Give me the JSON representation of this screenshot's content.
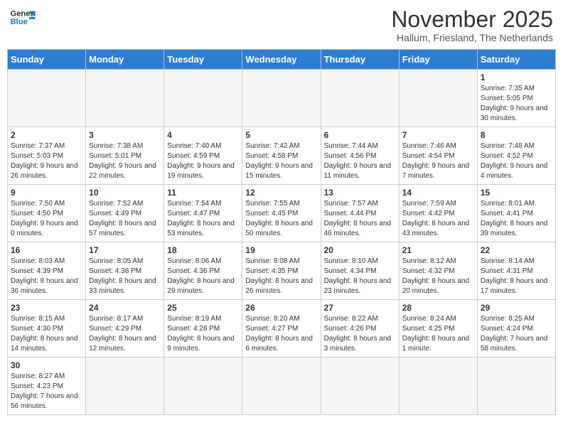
{
  "logo": {
    "text_general": "General",
    "text_blue": "Blue"
  },
  "title": "November 2025",
  "subtitle": "Hallum, Friesland, The Netherlands",
  "days_of_week": [
    "Sunday",
    "Monday",
    "Tuesday",
    "Wednesday",
    "Thursday",
    "Friday",
    "Saturday"
  ],
  "weeks": [
    [
      {
        "day": "",
        "info": ""
      },
      {
        "day": "",
        "info": ""
      },
      {
        "day": "",
        "info": ""
      },
      {
        "day": "",
        "info": ""
      },
      {
        "day": "",
        "info": ""
      },
      {
        "day": "",
        "info": ""
      },
      {
        "day": "1",
        "info": "Sunrise: 7:35 AM\nSunset: 5:05 PM\nDaylight: 9 hours and 30 minutes."
      }
    ],
    [
      {
        "day": "2",
        "info": "Sunrise: 7:37 AM\nSunset: 5:03 PM\nDaylight: 9 hours and 26 minutes."
      },
      {
        "day": "3",
        "info": "Sunrise: 7:38 AM\nSunset: 5:01 PM\nDaylight: 9 hours and 22 minutes."
      },
      {
        "day": "4",
        "info": "Sunrise: 7:40 AM\nSunset: 4:59 PM\nDaylight: 9 hours and 19 minutes."
      },
      {
        "day": "5",
        "info": "Sunrise: 7:42 AM\nSunset: 4:58 PM\nDaylight: 9 hours and 15 minutes."
      },
      {
        "day": "6",
        "info": "Sunrise: 7:44 AM\nSunset: 4:56 PM\nDaylight: 9 hours and 11 minutes."
      },
      {
        "day": "7",
        "info": "Sunrise: 7:46 AM\nSunset: 4:54 PM\nDaylight: 9 hours and 7 minutes."
      },
      {
        "day": "8",
        "info": "Sunrise: 7:48 AM\nSunset: 4:52 PM\nDaylight: 9 hours and 4 minutes."
      }
    ],
    [
      {
        "day": "9",
        "info": "Sunrise: 7:50 AM\nSunset: 4:50 PM\nDaylight: 9 hours and 0 minutes."
      },
      {
        "day": "10",
        "info": "Sunrise: 7:52 AM\nSunset: 4:49 PM\nDaylight: 8 hours and 57 minutes."
      },
      {
        "day": "11",
        "info": "Sunrise: 7:54 AM\nSunset: 4:47 PM\nDaylight: 8 hours and 53 minutes."
      },
      {
        "day": "12",
        "info": "Sunrise: 7:55 AM\nSunset: 4:45 PM\nDaylight: 8 hours and 50 minutes."
      },
      {
        "day": "13",
        "info": "Sunrise: 7:57 AM\nSunset: 4:44 PM\nDaylight: 8 hours and 46 minutes."
      },
      {
        "day": "14",
        "info": "Sunrise: 7:59 AM\nSunset: 4:42 PM\nDaylight: 8 hours and 43 minutes."
      },
      {
        "day": "15",
        "info": "Sunrise: 8:01 AM\nSunset: 4:41 PM\nDaylight: 8 hours and 39 minutes."
      }
    ],
    [
      {
        "day": "16",
        "info": "Sunrise: 8:03 AM\nSunset: 4:39 PM\nDaylight: 8 hours and 36 minutes."
      },
      {
        "day": "17",
        "info": "Sunrise: 8:05 AM\nSunset: 4:38 PM\nDaylight: 8 hours and 33 minutes."
      },
      {
        "day": "18",
        "info": "Sunrise: 8:06 AM\nSunset: 4:36 PM\nDaylight: 8 hours and 29 minutes."
      },
      {
        "day": "19",
        "info": "Sunrise: 8:08 AM\nSunset: 4:35 PM\nDaylight: 8 hours and 26 minutes."
      },
      {
        "day": "20",
        "info": "Sunrise: 8:10 AM\nSunset: 4:34 PM\nDaylight: 8 hours and 23 minutes."
      },
      {
        "day": "21",
        "info": "Sunrise: 8:12 AM\nSunset: 4:32 PM\nDaylight: 8 hours and 20 minutes."
      },
      {
        "day": "22",
        "info": "Sunrise: 8:14 AM\nSunset: 4:31 PM\nDaylight: 8 hours and 17 minutes."
      }
    ],
    [
      {
        "day": "23",
        "info": "Sunrise: 8:15 AM\nSunset: 4:30 PM\nDaylight: 8 hours and 14 minutes."
      },
      {
        "day": "24",
        "info": "Sunrise: 8:17 AM\nSunset: 4:29 PM\nDaylight: 8 hours and 12 minutes."
      },
      {
        "day": "25",
        "info": "Sunrise: 8:19 AM\nSunset: 4:28 PM\nDaylight: 8 hours and 9 minutes."
      },
      {
        "day": "26",
        "info": "Sunrise: 8:20 AM\nSunset: 4:27 PM\nDaylight: 8 hours and 6 minutes."
      },
      {
        "day": "27",
        "info": "Sunrise: 8:22 AM\nSunset: 4:26 PM\nDaylight: 8 hours and 3 minutes."
      },
      {
        "day": "28",
        "info": "Sunrise: 8:24 AM\nSunset: 4:25 PM\nDaylight: 8 hours and 1 minute."
      },
      {
        "day": "29",
        "info": "Sunrise: 8:25 AM\nSunset: 4:24 PM\nDaylight: 7 hours and 58 minutes."
      }
    ],
    [
      {
        "day": "30",
        "info": "Sunrise: 8:27 AM\nSunset: 4:23 PM\nDaylight: 7 hours and 56 minutes."
      },
      {
        "day": "",
        "info": ""
      },
      {
        "day": "",
        "info": ""
      },
      {
        "day": "",
        "info": ""
      },
      {
        "day": "",
        "info": ""
      },
      {
        "day": "",
        "info": ""
      },
      {
        "day": "",
        "info": ""
      }
    ]
  ]
}
